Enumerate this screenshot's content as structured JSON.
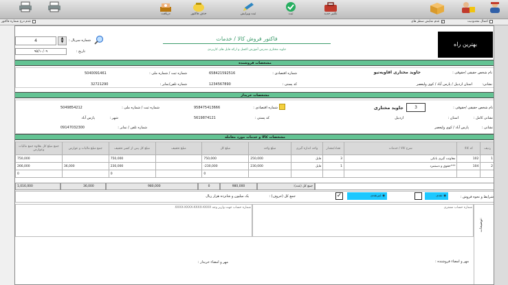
{
  "toolbar": {
    "items": [
      {
        "label": "",
        "icon": "user-icon"
      },
      {
        "label": "",
        "icon": "lock-icon"
      },
      {
        "label": "",
        "icon": "box-icon"
      },
      {
        "label": "تکثیر جدید",
        "icon": "toolbox-icon"
      },
      {
        "label": "ثبت",
        "icon": "check-icon"
      },
      {
        "label": "ثبت ویرایش",
        "icon": "pen-icon"
      },
      {
        "label": "حذف فاکتور",
        "icon": "delete-icon"
      },
      {
        "label": "دریافت",
        "icon": "money-icon"
      },
      {
        "label": "",
        "icon": "printer-icon"
      },
      {
        "label": "",
        "icon": "printer2-icon"
      }
    ]
  },
  "options": {
    "active_only": "اعمال محدودیت",
    "show_full": "عدم نمایش سطر های",
    "print_number": "عدم درج شماره فاکتور"
  },
  "header": {
    "title": "فاکتور فروش کالا / خدمات",
    "subtitle": "جاوید مختاری مدرس آموزش اکسل و ارائه فایل های کاربردی",
    "serial_label": "شماره سریال :",
    "serial_value": "4",
    "date_label": "تاریخ :",
    "date_value": "۹۵/۱۰/۰۹",
    "logo_text": "بهترین راه"
  },
  "seller": {
    "section": "مشخصات فروشنده",
    "name_label": "نام شخص حقیقی /حقوقی :",
    "name_value": "جاوید مختاری اقاویه‌تیو",
    "eco_label": "شماره اقتصادی :",
    "eco_value": "658421592516",
    "reg_label": "شماره ثبت / شماره ملی :",
    "reg_value": "5040091461",
    "addr_label": "نشانی:",
    "addr_value": "استان اردبیل / پارس آباد / کوی ولیعصر",
    "postal_label": "کد پستی :",
    "postal_value": "1234567890",
    "phone_label": "شماره تلفن/نمابر :",
    "phone_value": "32721290"
  },
  "buyer": {
    "section": "مشخصات خریدار",
    "name_label": "نام شخص حقیقی /حقوقی :",
    "code_value": "3",
    "name_value": "جاوید مختاری",
    "eco_label": "شماره اقتصادی :",
    "eco_value": "958475413666",
    "reg_label": "شماره ثبت / شماره ملی :",
    "reg_value": "5049854212",
    "full_addr_label": "نشانی کامل :",
    "province_label": "استان :",
    "province_value": "اردبیل",
    "postal_label": "کد پستی :",
    "postal_value": "5619874121",
    "city_label": "شهر :",
    "city_value": "پارس آباد",
    "addr_label": "نشانی :",
    "addr_value": "پارس آباد / کوی ولیعصر",
    "phone_label": "شماره تلفن / نمابر :",
    "phone_value": "09147032300"
  },
  "items": {
    "section": "مشخصات کالا و خدمات مورد معامله",
    "columns": [
      "ردیف",
      "کد کالا",
      "شرح کالا / خدمات",
      "تعداد/مقدار",
      "واحد اندازه گیری",
      "مبلغ واحد",
      "مبلغ کل",
      "مبلغ تخفیف",
      "مبلغ کل پس از کسر تخفیف",
      "جمع مبلغ مالیات و عوارض",
      "جمع مبلغ کل بعلاوه جمع مالیات وعوارض"
    ],
    "rows": [
      [
        "1",
        "102",
        "معاونت گیری بانکی",
        "3",
        "فایل",
        "250,000",
        "750,000",
        "",
        "750,000",
        "",
        "750,000"
      ],
      [
        "2",
        "104",
        "حقوق و دستمزد***",
        "1",
        "فایل",
        "230,000",
        "-230,000",
        "",
        "230,000",
        "36,000",
        "266,000"
      ],
      [
        "",
        "",
        "",
        "",
        "",
        "",
        "0",
        "",
        "0",
        "",
        "0"
      ]
    ],
    "total_label": "جمع کل (عدد):",
    "total_cells": [
      "980,000",
      "0",
      "980,000",
      "36,000",
      "1,016,000"
    ],
    "words_label": "جمع کل (حروف) :",
    "words_value": "یک میلیون و شانزده هزار ریال"
  },
  "payment": {
    "label": "شرایط و نحوه فروش :",
    "cash": "نقدی",
    "credit": "غیرنقدی"
  },
  "footer": {
    "buyer_account_label": "شماره حساب مشتری",
    "seller_account_label": "شماره حساب جهت واریز وجه",
    "seller_account_value": "XXXX-XXXX-XXXX-XXXX",
    "notes_label": "توضیحات:",
    "seller_sign": "مهر و امضاء فروشنده :",
    "buyer_sign": "مهر و امضاء خریدار :"
  },
  "colors": {
    "accent": "#63c393"
  }
}
